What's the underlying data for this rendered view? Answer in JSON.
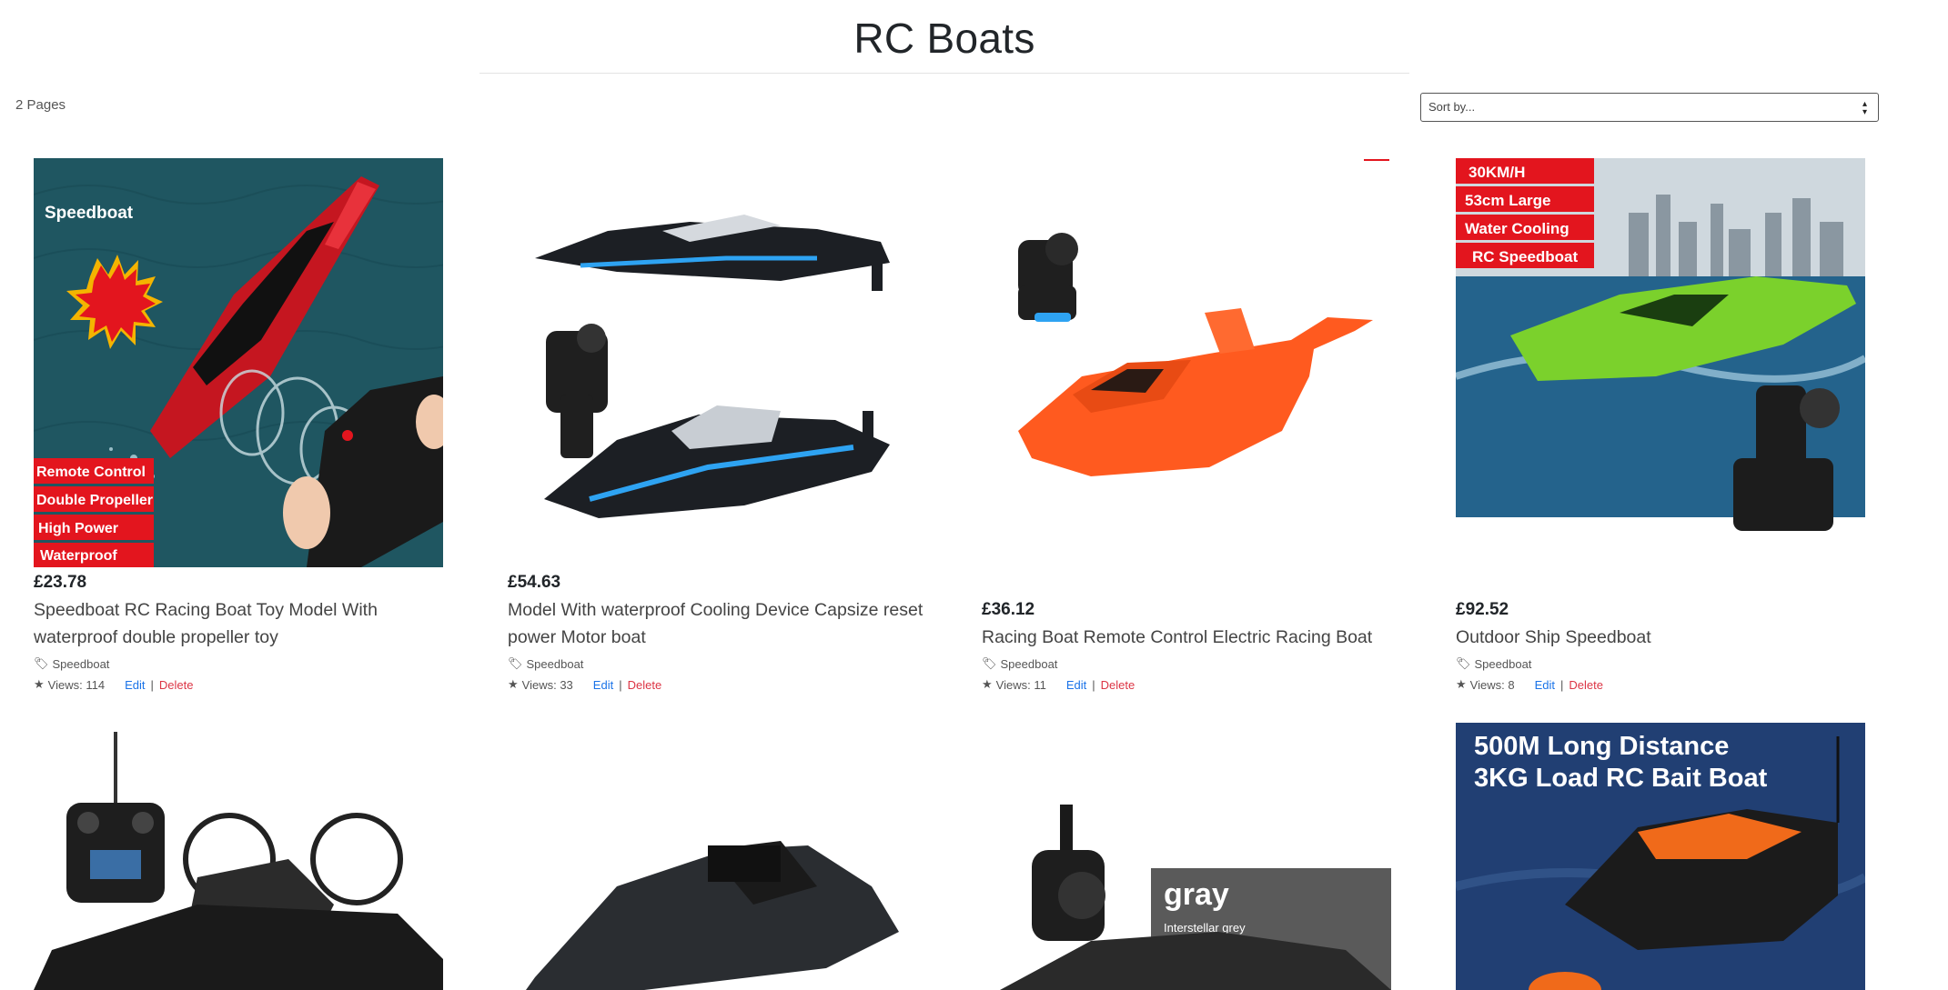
{
  "header": {
    "title": "RC Boats"
  },
  "pagination": {
    "pages_label": "2 Pages"
  },
  "sort": {
    "placeholder": "Sort by..."
  },
  "actions": {
    "edit": "Edit",
    "sep": "|",
    "delete": "Delete"
  },
  "products": [
    {
      "price": "£23.78",
      "title": "Speedboat RC Racing Boat Toy Model With waterproof double propeller toy",
      "category": "Speedboat",
      "views": "Views: 114",
      "image_badges": [
        "Speedboat",
        "Remote Control",
        "Double Propeller",
        "High Power",
        "Waterproof"
      ]
    },
    {
      "price": "£54.63",
      "title": "Model With waterproof Cooling Device Capsize reset power Motor boat",
      "category": "Speedboat",
      "views": "Views: 33"
    },
    {
      "price": "£36.12",
      "title": "Racing Boat Remote Control Electric Racing Boat",
      "category": "Speedboat",
      "views": "Views: 11"
    },
    {
      "price": "£92.52",
      "title": "Outdoor Ship Speedboat",
      "category": "Speedboat",
      "views": "Views: 8",
      "image_badges": [
        "30KM/H",
        "53cm Large",
        "Water Cooling",
        "RC Speedboat"
      ]
    }
  ],
  "row2_images": {
    "img7_text": [
      "gray",
      "Interstellar grey"
    ],
    "img8_text": [
      "500M Long Distance",
      "3KG Load RC Bait Boat"
    ]
  },
  "colors": {
    "edit": "#1a73e8",
    "delete": "#dc3545",
    "badge_red": "#e3151e"
  }
}
